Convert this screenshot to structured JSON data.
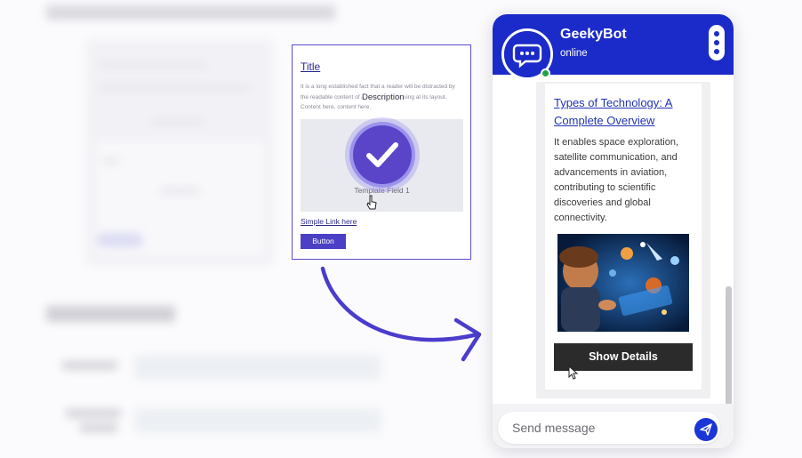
{
  "template_card": {
    "title": "Title",
    "description_text": "It is a long established fact that a reader will be distracted by the readable content of a page when looking at its layout. Content here, content here.",
    "description_label": "Description",
    "field_label": "Template Field 1",
    "link_text": "Simple Link here",
    "button_label": "Button"
  },
  "chat": {
    "bot_name": "GeekyBot",
    "status": "online",
    "header_color": "#1b2bc9",
    "status_color": "#1ea446",
    "message": {
      "title": "Types of Technology: A Complete Overview",
      "text": "It enables space exploration, satellite communication, and advancements in aviation, contributing to scientific discoveries and global connectivity.",
      "button_label": "Show Details"
    },
    "input_placeholder": "Send message"
  },
  "icons": {
    "check": "check-icon",
    "arrow": "curved-arrow-icon",
    "avatar": "chat-bubble-icon",
    "menu": "kebab-menu-icon",
    "send": "send-icon",
    "cursor": "mouse-pointer-icon"
  }
}
